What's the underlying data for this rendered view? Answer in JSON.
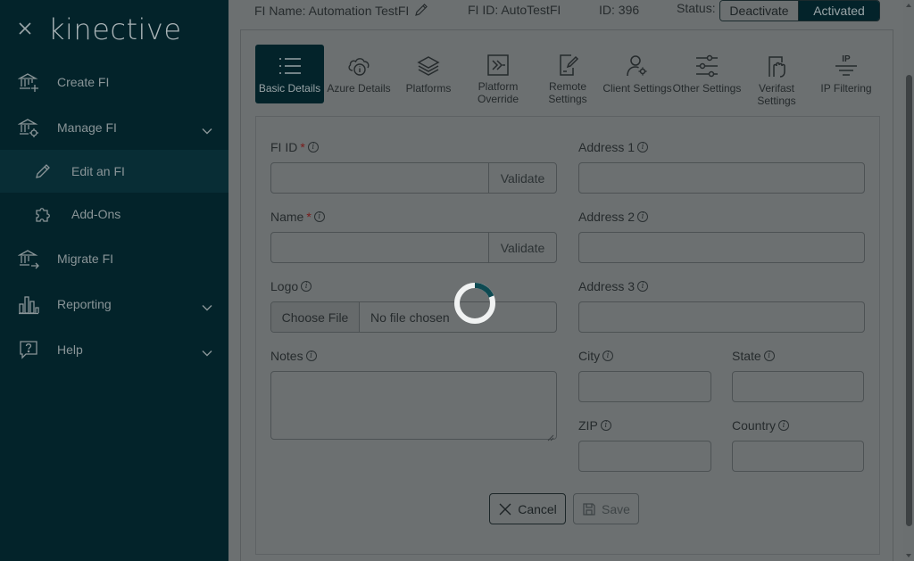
{
  "brand": {
    "logo_text": "kinective"
  },
  "sidebar": {
    "items": [
      {
        "label": "Create FI"
      },
      {
        "label": "Manage FI"
      },
      {
        "label": "Edit an FI"
      },
      {
        "label": "Add-Ons"
      },
      {
        "label": "Migrate FI"
      },
      {
        "label": "Reporting"
      },
      {
        "label": "Help"
      }
    ]
  },
  "header": {
    "fi_name": "FI Name: Automation TestFI",
    "fi_id": "FI ID: AutoTestFI",
    "id": "ID: 396",
    "status_label": "Status:",
    "deactivate": "Deactivate",
    "activated": "Activated"
  },
  "tabs": [
    {
      "label": "Basic Details"
    },
    {
      "label": "Azure Details"
    },
    {
      "label": "Platforms"
    },
    {
      "label": "Platform Override"
    },
    {
      "label": "Remote Settings"
    },
    {
      "label": "Client Settings"
    },
    {
      "label": "Other Settings"
    },
    {
      "label": "Verifast Settings"
    },
    {
      "label": "IP Filtering"
    }
  ],
  "form": {
    "fi_id_label": "FI ID",
    "name_label": "Name",
    "required_mark": "*",
    "validate": "Validate",
    "logo_label": "Logo",
    "choose_file": "Choose File",
    "no_file": "No file chosen",
    "notes_label": "Notes",
    "address1_label": "Address 1",
    "address2_label": "Address 2",
    "address3_label": "Address 3",
    "city_label": "City",
    "state_label": "State",
    "zip_label": "ZIP",
    "country_label": "Country",
    "info_glyph": "i",
    "ip_glyph": "IP",
    "cancel": "Cancel",
    "save": "Save"
  },
  "colors": {
    "sidebar_bg": "#03232a",
    "overlay": "#6c7071",
    "accent": "#0e4a52"
  }
}
